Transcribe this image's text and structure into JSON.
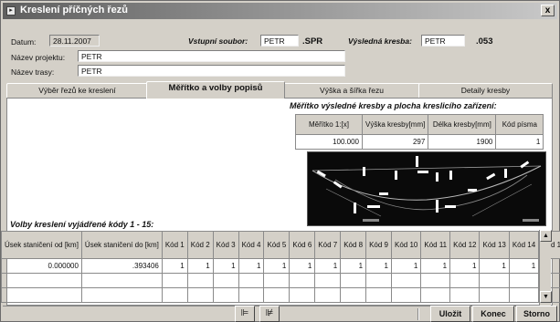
{
  "window": {
    "title": "Kreslení příčných řezů",
    "close_label": "x"
  },
  "header": {
    "datum_label": "Datum:",
    "datum_value": "28.11.2007",
    "vstupni_label": "Vstupní soubor:",
    "vstupni_value": "PETR",
    "vstupni_ext": ".SPR",
    "vysledna_label": "Výsledná kresba:",
    "vysledna_value": "PETR",
    "vysledna_ext": ".053",
    "projekt_label": "Název projektu:",
    "projekt_value": "PETR",
    "trasa_label": "Název trasy:",
    "trasa_value": "PETR"
  },
  "tabs": [
    {
      "label": "Výběr řezů ke kreslení"
    },
    {
      "label": "Měřítko a volby popisů"
    },
    {
      "label": "Výška a šířka řezu"
    },
    {
      "label": "Detaily kresby"
    }
  ],
  "scale_section": {
    "title": "Měřítko výsledné kresby a plocha kreslicího zařízení:",
    "headers": [
      "Měřítko 1:[x]",
      "Výška kresby[mm]",
      "Délka kresby[mm]",
      "Kód písma"
    ],
    "values": [
      "100.000",
      "297",
      "1900",
      "1"
    ]
  },
  "codes_section": {
    "title": "Volby kreslení vyjádřené kódy 1 - 15:",
    "headers": [
      "Úsek staničení od [km]",
      "Úsek staničení do [km]",
      "Kód 1",
      "Kód 2",
      "Kód 3",
      "Kód 4",
      "Kód 5",
      "Kód 6",
      "Kód 7",
      "Kód 8",
      "Kód 9",
      "Kód 10",
      "Kód 11",
      "Kód 12",
      "Kód 13",
      "Kód 14",
      "Kód 15"
    ],
    "row": [
      "0.000000",
      ".393406",
      "1",
      "1",
      "1",
      "1",
      "1",
      "1",
      "1",
      "1",
      "1",
      "1",
      "1",
      "1",
      "1",
      "1",
      "0"
    ]
  },
  "buttons": {
    "save": "Uložit",
    "end": "Konec",
    "cancel": "Storno"
  },
  "icons": [
    "insert-row-icon",
    "delete-row-icon",
    "scroll-up-icon",
    "scroll-down-icon"
  ]
}
